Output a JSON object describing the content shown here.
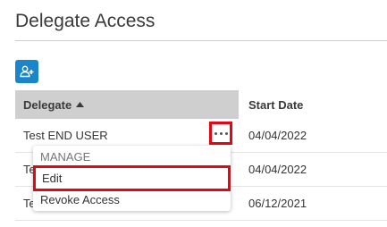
{
  "page": {
    "title": "Delegate Access"
  },
  "toolbar": {
    "add_icon": "add-user-icon",
    "accent": "#1a85c8"
  },
  "table": {
    "columns": {
      "delegate": "Delegate",
      "start_date": "Start Date"
    },
    "sort": {
      "column": "Delegate",
      "direction": "ascending"
    },
    "rows": [
      {
        "name": "Test END USER",
        "start_date": "04/04/2022"
      },
      {
        "name": "Te",
        "start_date": "04/04/2022"
      },
      {
        "name": "Te",
        "start_date": "06/12/2021"
      }
    ]
  },
  "menu": {
    "header": "MANAGE",
    "items": [
      "Edit",
      "Revoke Access"
    ]
  },
  "highlight_color": "#e30613"
}
